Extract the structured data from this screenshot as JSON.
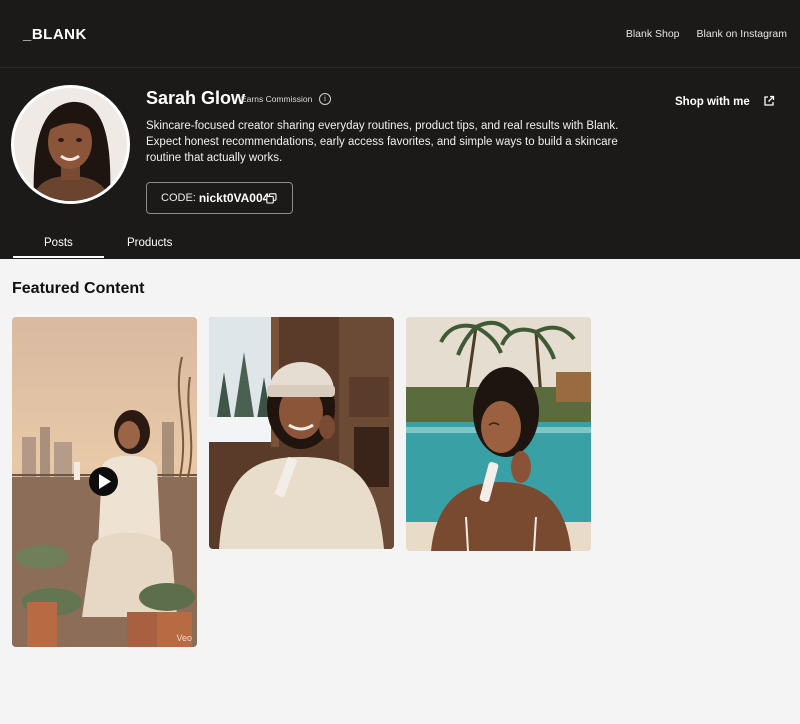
{
  "header": {
    "logo": "_BLANK",
    "nav": [
      "Blank Shop",
      "Blank on Instagram"
    ]
  },
  "profile": {
    "name": "Sarah Glow",
    "badge": "Earns Commission",
    "info_icon": "info-icon",
    "bio": "Skincare-focused creator sharing everyday routines, product tips, and real results with Blank. Expect honest recommendations, early access favorites, and simple ways to build a skincare routine that actually works.",
    "code_label": "CODE:",
    "code_value": "nickt0VA004",
    "copy_icon": "copy-icon",
    "shop_label": "Shop with me",
    "shop_icon": "external-link-icon"
  },
  "tabs": [
    {
      "label": "Posts",
      "active": true
    },
    {
      "label": "Products",
      "active": false
    }
  ],
  "featured": {
    "title": "Featured Content",
    "cards": [
      {
        "kind": "video",
        "scene": "rooftop at sunset with succulents",
        "watermark": "Veo"
      },
      {
        "kind": "image",
        "scene": "winter cabin with beanie"
      },
      {
        "kind": "image",
        "scene": "tropical poolside with palms"
      }
    ]
  },
  "colors": {
    "header_bg": "#1c1919",
    "page_bg": "#f4f4f4",
    "text_light": "#ffffff",
    "text_dark": "#111111"
  }
}
